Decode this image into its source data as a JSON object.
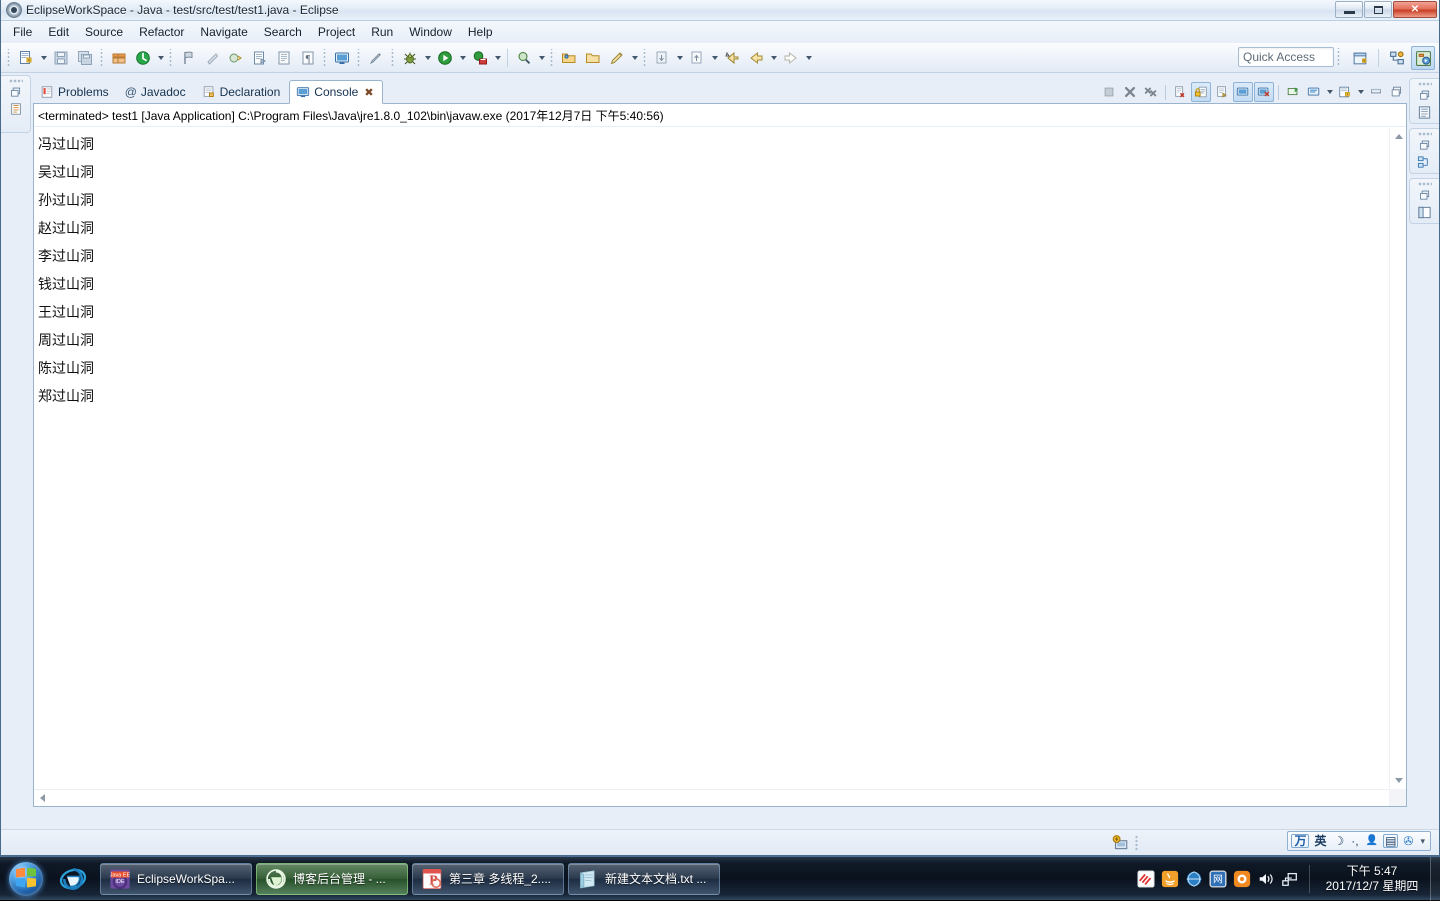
{
  "window": {
    "title": "EclipseWorkSpace - Java - test/src/test/test1.java - Eclipse",
    "app_icon": "eclipse-icon",
    "controls": {
      "minimize": "minimize",
      "maximize": "maximize",
      "close": "close"
    }
  },
  "menubar": {
    "items": [
      {
        "label": "File"
      },
      {
        "label": "Edit"
      },
      {
        "label": "Source"
      },
      {
        "label": "Refactor"
      },
      {
        "label": "Navigate"
      },
      {
        "label": "Search"
      },
      {
        "label": "Project"
      },
      {
        "label": "Run"
      },
      {
        "label": "Window"
      },
      {
        "label": "Help"
      }
    ]
  },
  "toolbar": {
    "quick_access_placeholder": "Quick Access",
    "quick_access_value": "",
    "buttons": [
      {
        "name": "new-wizard",
        "icon": "new-file-icon"
      },
      {
        "name": "save",
        "icon": "save-icon"
      },
      {
        "name": "save-all",
        "icon": "save-all-icon"
      },
      {
        "name": "new-java-package",
        "icon": "package-icon"
      },
      {
        "name": "build-all",
        "icon": "build-icon"
      },
      {
        "name": "print",
        "icon": "print-icon"
      },
      {
        "name": "toggle-mark-occurrences",
        "icon": "marker-icon"
      },
      {
        "name": "skip-all-breakpoints",
        "icon": "breakpoint-skip-icon"
      },
      {
        "name": "new-java-class",
        "icon": "java-class-icon"
      },
      {
        "name": "new-java-interface",
        "icon": "java-interface-icon"
      },
      {
        "name": "open-type",
        "icon": "open-type-icon"
      },
      {
        "name": "open-task",
        "icon": "task-icon"
      },
      {
        "name": "console-view",
        "icon": "console-icon"
      },
      {
        "name": "link-editor",
        "icon": "pencil-icon"
      },
      {
        "name": "debug",
        "icon": "debug-bug-icon"
      },
      {
        "name": "run",
        "icon": "run-play-icon"
      },
      {
        "name": "run-external-tools",
        "icon": "external-tools-icon"
      },
      {
        "name": "search",
        "icon": "search-icon"
      },
      {
        "name": "open-resource",
        "icon": "open-folder-icon"
      },
      {
        "name": "last-edit-location",
        "icon": "folder-icon"
      },
      {
        "name": "edit-pencil",
        "icon": "pencil-edit-icon"
      },
      {
        "name": "next-annotation",
        "icon": "next-annotation-icon"
      },
      {
        "name": "previous-annotation",
        "icon": "previous-annotation-icon"
      },
      {
        "name": "back-cursor",
        "icon": "back-cursor-icon"
      },
      {
        "name": "back",
        "icon": "back-arrow-icon"
      },
      {
        "name": "forward",
        "icon": "forward-arrow-icon"
      }
    ],
    "perspective": [
      {
        "name": "open-perspective",
        "icon": "open-perspective-icon",
        "active": false
      },
      {
        "name": "perspective-java-ee",
        "icon": "java-ee-perspective-icon",
        "active": false
      },
      {
        "name": "perspective-java",
        "icon": "java-perspective-icon",
        "active": true
      }
    ]
  },
  "fastview": {
    "left": [
      {
        "name": "restore-icon"
      },
      {
        "name": "package-explorer-icon"
      }
    ],
    "right": [
      {
        "name": "restore-icon"
      },
      {
        "name": "outline-icon"
      },
      {
        "name": "restore-icon"
      },
      {
        "name": "hierarchy-icon"
      },
      {
        "name": "restore-icon"
      },
      {
        "name": "task-list-icon"
      }
    ]
  },
  "view_tabs": [
    {
      "label": "Problems",
      "icon": "problems-icon",
      "active": false,
      "closable": false
    },
    {
      "label": "Javadoc",
      "icon": "javadoc-at-icon",
      "active": false,
      "closable": false
    },
    {
      "label": "Declaration",
      "icon": "declaration-icon",
      "active": false,
      "closable": false
    },
    {
      "label": "Console",
      "icon": "console-icon",
      "active": true,
      "closable": true
    }
  ],
  "view_toolbar": [
    {
      "name": "terminate",
      "icon": "terminate-stop-icon",
      "pressed": false,
      "enabled": false
    },
    {
      "name": "remove-launch",
      "icon": "remove-x-icon",
      "pressed": false,
      "enabled": true
    },
    {
      "name": "remove-all-terminated",
      "icon": "remove-all-xx-icon",
      "pressed": false,
      "enabled": true
    },
    {
      "name": "clear-console",
      "icon": "clear-console-icon",
      "pressed": false,
      "enabled": true
    },
    {
      "name": "scroll-lock",
      "icon": "scroll-lock-icon",
      "pressed": true,
      "enabled": true
    },
    {
      "name": "word-wrap",
      "icon": "word-wrap-icon",
      "pressed": false,
      "enabled": true
    },
    {
      "name": "show-console-on-output",
      "icon": "show-on-output-icon",
      "pressed": true,
      "enabled": true
    },
    {
      "name": "show-console-on-error",
      "icon": "show-on-error-icon",
      "pressed": true,
      "enabled": true
    },
    {
      "name": "pin-console",
      "icon": "pin-console-icon",
      "pressed": false,
      "enabled": true
    },
    {
      "name": "display-selected-console",
      "icon": "display-console-icon",
      "pressed": false,
      "enabled": true
    },
    {
      "name": "open-console",
      "icon": "open-console-icon",
      "pressed": false,
      "enabled": true
    },
    {
      "name": "minimize",
      "icon": "minimize-view-icon",
      "pressed": false,
      "enabled": true
    },
    {
      "name": "maximize",
      "icon": "maximize-view-icon",
      "pressed": false,
      "enabled": true
    }
  ],
  "console": {
    "header": "<terminated> test1 [Java Application] C:\\Program Files\\Java\\jre1.8.0_102\\bin\\javaw.exe (2017年12月7日 下午5:40:56)",
    "lines": [
      "冯过山洞",
      "吴过山洞",
      "孙过山洞",
      "赵过山洞",
      "李过山洞",
      "钱过山洞",
      "王过山洞",
      "周过山洞",
      "陈过山洞",
      "郑过山洞"
    ]
  },
  "statusbar": {
    "heap_icon": "heap-status-icon"
  },
  "ime": {
    "items": [
      {
        "name": "ime-logo",
        "glyph": "万"
      },
      {
        "name": "ime-mode-english",
        "glyph": "英"
      },
      {
        "name": "ime-moon",
        "glyph": "☽"
      },
      {
        "name": "ime-punctuation",
        "glyph": "·,"
      },
      {
        "name": "ime-user",
        "glyph": "👤"
      },
      {
        "name": "ime-soft-keyboard",
        "glyph": "▤"
      },
      {
        "name": "ime-settings",
        "glyph": "✇"
      }
    ]
  },
  "taskbar": {
    "start": "start-orb",
    "quicklaunch": [
      {
        "name": "internet-explorer-icon"
      }
    ],
    "tasks": [
      {
        "label": "EclipseWorkSpa...",
        "icon": "eclipse-java-ee-icon",
        "active": true,
        "color": "gray"
      },
      {
        "label": "博客后台管理 - ...",
        "icon": "browser-green-icon",
        "active": false,
        "color": "green"
      },
      {
        "label": "第三章 多线程_2....",
        "icon": "powerpoint-icon",
        "active": false,
        "color": "gray"
      },
      {
        "label": "新建文本文档.txt ...",
        "icon": "notepad-icon",
        "active": false,
        "color": "gray"
      }
    ],
    "tray": [
      {
        "name": "tray-xunlei-icon",
        "glyph": "迅"
      },
      {
        "name": "tray-java-icon",
        "glyph": "☕"
      },
      {
        "name": "tray-globe-icon",
        "glyph": "◍"
      },
      {
        "name": "tray-netease-icon",
        "glyph": "网"
      },
      {
        "name": "tray-shield-icon",
        "glyph": "◉"
      },
      {
        "name": "tray-volume-icon",
        "glyph": "🔊"
      },
      {
        "name": "tray-network-icon",
        "glyph": "🖧"
      }
    ],
    "clock": {
      "time": "下午 5:47",
      "date": "2017/12/7 星期四"
    }
  }
}
